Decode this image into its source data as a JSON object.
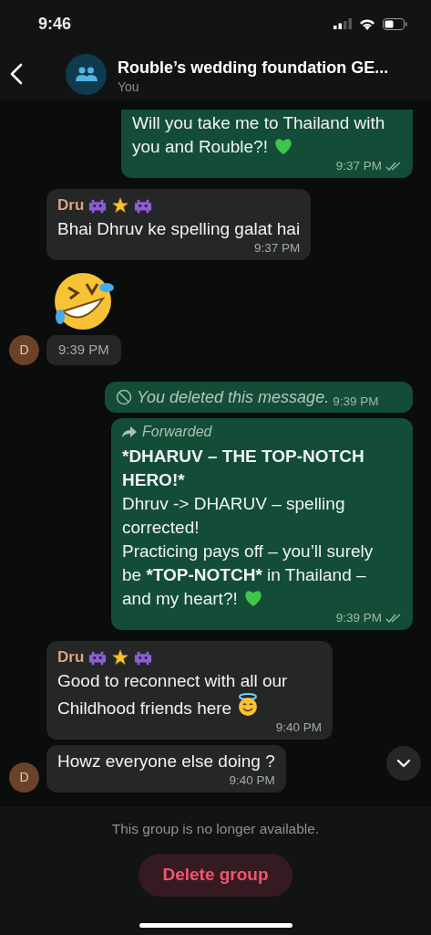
{
  "status_bar": {
    "time": "9:46"
  },
  "header": {
    "title": "Rouble’s wedding foundation GE...",
    "subtitle": "You"
  },
  "messages": [
    {
      "kind": "outgoing",
      "lines": [
        [
          {
            "text": "Will you take me to Thailand with you and Rouble?!"
          }
        ]
      ],
      "heart": true,
      "time": "9:37 PM",
      "delivered": true
    },
    {
      "kind": "incoming",
      "sender": "Dru",
      "sender_badges": true,
      "lines": [
        [
          {
            "text": "Bhai Dhruv ke spelling galat hai"
          }
        ]
      ],
      "time": "9:37 PM",
      "avatar": false
    },
    {
      "kind": "sticker",
      "time": "9:39 PM",
      "avatar": true,
      "avatar_letter": "D"
    },
    {
      "kind": "deleted",
      "text": "You deleted this message.",
      "time": "9:39 PM"
    },
    {
      "kind": "forwarded",
      "label": "Forwarded",
      "lines": [
        [
          {
            "text": "*DHARUV – THE TOP-NOTCH HERO!*",
            "bold": true
          }
        ],
        [
          {
            "text": "Dhruv -> DHARUV – spelling corrected!"
          }
        ],
        [
          {
            "text": "Practicing pays off – you’ll surely be "
          },
          {
            "text": "*TOP-NOTCH*",
            "bold": true
          },
          {
            "text": " in Thailand – and my heart?!"
          }
        ]
      ],
      "heart": true,
      "time": "9:39 PM",
      "delivered": true
    },
    {
      "kind": "incoming",
      "sender": "Dru",
      "sender_badges": true,
      "lines": [
        [
          {
            "text": "Good to reconnect with all our Childhood friends here"
          }
        ]
      ],
      "halo_face": true,
      "time": "9:40 PM",
      "avatar": false
    },
    {
      "kind": "incoming",
      "lines": [
        [
          {
            "text": "Howz everyone else doing ?"
          }
        ]
      ],
      "time": "9:40 PM",
      "avatar": true,
      "avatar_letter": "D"
    }
  ],
  "footer": {
    "notice": "This group is no longer available.",
    "button": "Delete group"
  }
}
